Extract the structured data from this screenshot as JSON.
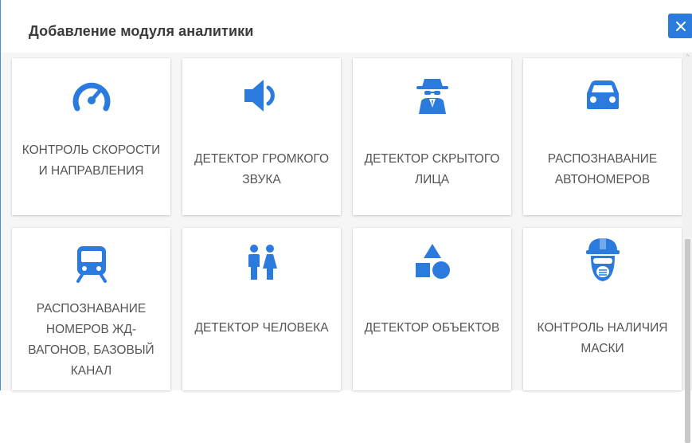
{
  "dialog": {
    "title": "Добавление модуля аналитики",
    "close_icon": "close-icon",
    "accent_color": "#2a7bdd"
  },
  "tiles": [
    {
      "label": "Контроль скорости и направления",
      "icon": "speedometer-icon"
    },
    {
      "label": "Детектор громкого звука",
      "icon": "volume-icon"
    },
    {
      "label": "Детектор скрытого лица",
      "icon": "user-secret-icon"
    },
    {
      "label": "Распознавание автономеров",
      "icon": "car-icon"
    },
    {
      "label": "Распознавание номеров жд-вагонов, базовый канал",
      "icon": "train-icon"
    },
    {
      "label": "Детектор человека",
      "icon": "people-icon"
    },
    {
      "label": "Детектор объектов",
      "icon": "shapes-icon"
    },
    {
      "label": "Контроль наличия маски",
      "icon": "hardhat-mask-icon"
    }
  ]
}
